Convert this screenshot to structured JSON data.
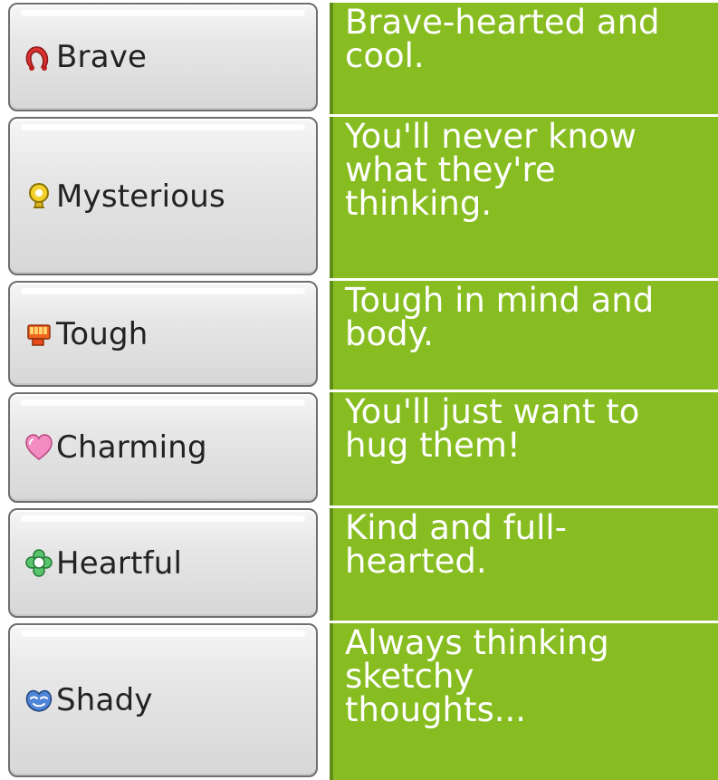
{
  "rows": [
    {
      "personality": "Brave",
      "description": "Brave-hearted and\ncool.",
      "icon": "brave-horseshoe-icon",
      "icon_color": "#d93232"
    },
    {
      "personality": "Mysterious",
      "description": "You'll never know\nwhat they're\nthinking.",
      "icon": "mysterious-lightbulb-icon",
      "icon_color": "#f3d12c"
    },
    {
      "personality": "Tough",
      "description": "Tough in mind and\nbody.",
      "icon": "tough-fist-icon",
      "icon_color": "#ef6421"
    },
    {
      "personality": "Charming",
      "description": "You'll just want to\nhug them!",
      "icon": "charming-heart-icon",
      "icon_color": "#f28cc1"
    },
    {
      "personality": "Heartful",
      "description": "Kind and full-\nhearted.",
      "icon": "heartful-flower-icon",
      "icon_color": "#59c46d"
    },
    {
      "personality": "Shady",
      "description": "Always thinking\nsketchy\nthoughts...",
      "icon": "shady-mask-icon",
      "icon_color": "#4f85d8"
    }
  ],
  "colors": {
    "description_background": "#87bd21",
    "description_text": "#ffffff",
    "tab_border": "#6f6f6f"
  }
}
